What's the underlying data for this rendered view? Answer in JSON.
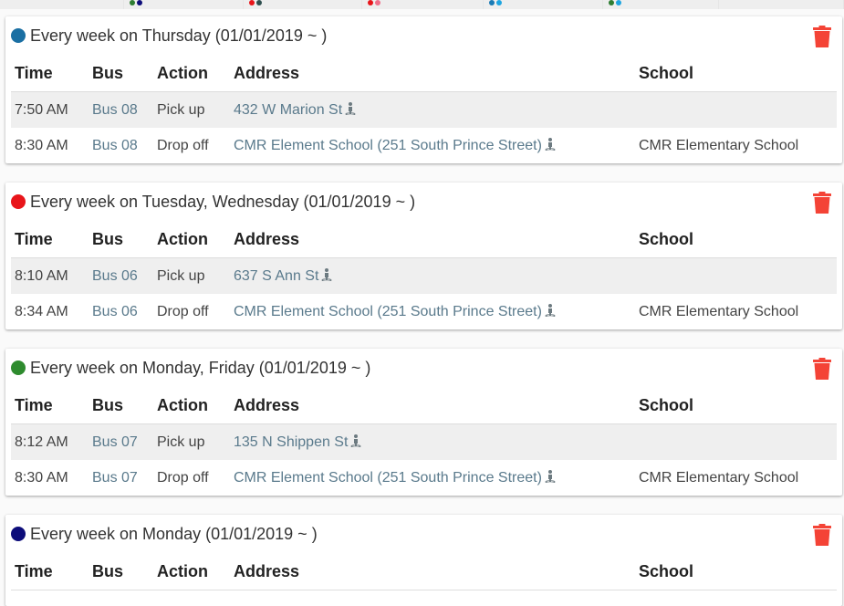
{
  "top_strip": [
    {
      "dots": []
    },
    {
      "dots": [
        "#2e7d32",
        "#0d0d7a"
      ]
    },
    {
      "dots": [
        "#e8151a",
        "#2f4f4f"
      ]
    },
    {
      "dots": [
        "#e8151a",
        "#f06f8a"
      ]
    },
    {
      "dots": [
        "#1a7bb5",
        "#1ea5e0"
      ]
    },
    {
      "dots": [
        "#2e7d32",
        "#1ea5e0"
      ]
    },
    {
      "dots": []
    }
  ],
  "columns": {
    "time": "Time",
    "bus": "Bus",
    "action": "Action",
    "address": "Address",
    "school": "School"
  },
  "schedules": [
    {
      "color": "#1a6fa3",
      "title": "Every week on Thursday (01/01/2019 ~ )",
      "rows": [
        {
          "time": "7:50 AM",
          "bus": "Bus 08",
          "action": "Pick up",
          "address": "432 W Marion St",
          "school": ""
        },
        {
          "time": "8:30 AM",
          "bus": "Bus 08",
          "action": "Drop off",
          "address": "CMR Element School (251 South Prince Street)",
          "school": "CMR Elementary School"
        }
      ]
    },
    {
      "color": "#e8151a",
      "title": "Every week on Tuesday, Wednesday (01/01/2019 ~ )",
      "rows": [
        {
          "time": "8:10 AM",
          "bus": "Bus 06",
          "action": "Pick up",
          "address": "637 S Ann St",
          "school": ""
        },
        {
          "time": "8:34 AM",
          "bus": "Bus 06",
          "action": "Drop off",
          "address": "CMR Element School (251 South Prince Street)",
          "school": "CMR Elementary School"
        }
      ]
    },
    {
      "color": "#2e8b2e",
      "title": "Every week on Monday, Friday (01/01/2019 ~ )",
      "rows": [
        {
          "time": "8:12 AM",
          "bus": "Bus 07",
          "action": "Pick up",
          "address": "135 N Shippen St",
          "school": ""
        },
        {
          "time": "8:30 AM",
          "bus": "Bus 07",
          "action": "Drop off",
          "address": "CMR Element School (251 South Prince Street)",
          "school": "CMR Elementary School"
        }
      ]
    },
    {
      "color": "#0d0d7a",
      "title": "Every week on Monday (01/01/2019 ~ )",
      "rows": []
    }
  ],
  "icons": {
    "delete": "trash-icon",
    "location": "walking-person-icon"
  },
  "colors": {
    "delete": "#f44336",
    "link": "#5a7a8c",
    "row_shade": "#efefef"
  }
}
